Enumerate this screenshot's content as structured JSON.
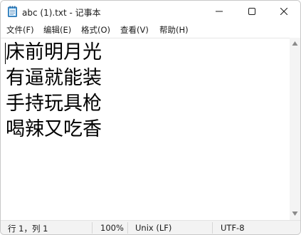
{
  "window": {
    "title": "abc (1).txt - 记事本",
    "app_icon": "notepad-icon",
    "controls": {
      "minimize_icon": "minimize-icon",
      "maximize_icon": "maximize-icon",
      "close_icon": "close-icon"
    }
  },
  "menu": {
    "items": [
      {
        "label": "文件(F)"
      },
      {
        "label": "编辑(E)"
      },
      {
        "label": "格式(O)"
      },
      {
        "label": "查看(V)"
      },
      {
        "label": "帮助(H)"
      }
    ]
  },
  "editor": {
    "lines": [
      "床前明月光",
      "有逼就能装",
      "手持玩具枪",
      "喝辣又吃香"
    ]
  },
  "statusbar": {
    "position": "行 1，列 1",
    "zoom": "100%",
    "line_ending": "Unix (LF)",
    "encoding": "UTF-8"
  }
}
